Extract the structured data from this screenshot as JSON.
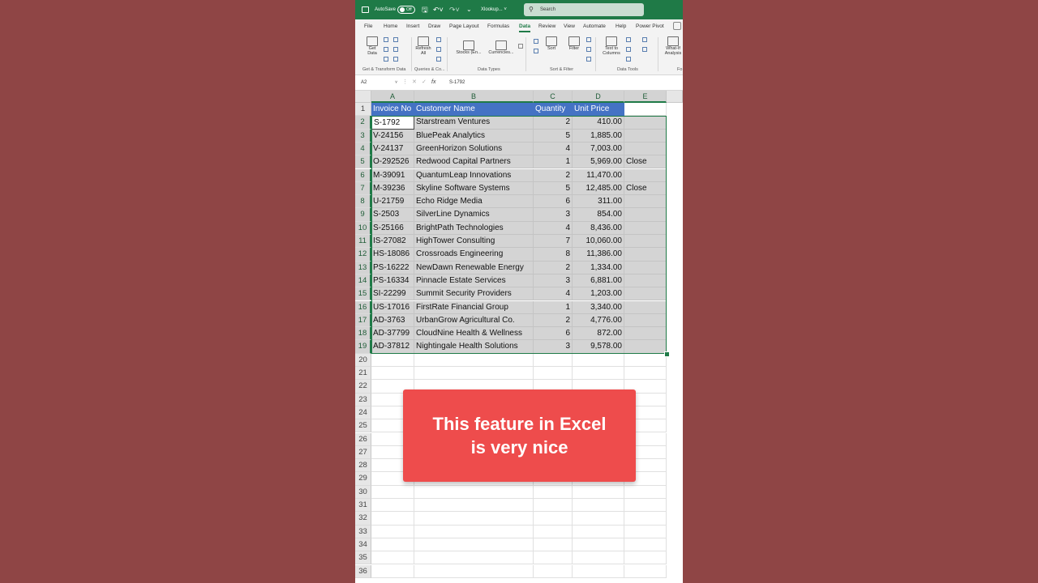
{
  "titlebar": {
    "autosave_label": "AutoSave",
    "toggle_label": "Off",
    "file_name": "Xlookup...",
    "search_placeholder": "Search"
  },
  "tabs": [
    {
      "label": "File"
    },
    {
      "label": "Home"
    },
    {
      "label": "Insert"
    },
    {
      "label": "Draw"
    },
    {
      "label": "Page Layout"
    },
    {
      "label": "Formulas"
    },
    {
      "label": "Data",
      "active": true
    },
    {
      "label": "Review"
    },
    {
      "label": "View"
    },
    {
      "label": "Automate"
    },
    {
      "label": "Help"
    },
    {
      "label": "Power Pivot"
    }
  ],
  "ribbon": {
    "get_data": "Get\nData",
    "refresh_all": "Refresh\nAll",
    "stocks": "Stocks (En...",
    "currencies": "Currencies...",
    "sort": "Sort",
    "filter": "Filter",
    "text_to_columns": "Text to\nColumns",
    "what_if": "What-If\nAnalysis",
    "groups": {
      "get_transform": "Get & Transform Data",
      "queries": "Queries & Co...",
      "data_types": "Data Types",
      "sort_filter": "Sort & Filter",
      "data_tools": "Data Tools",
      "forecast": "Fo"
    }
  },
  "formula_bar": {
    "name_box": "A2",
    "fx": "fx",
    "value": "S-1792"
  },
  "columns": [
    "A",
    "B",
    "C",
    "D",
    "E"
  ],
  "rows": [
    "1",
    "2",
    "3",
    "4",
    "5",
    "6",
    "7",
    "8",
    "9",
    "10",
    "11",
    "12",
    "13",
    "14",
    "15",
    "16",
    "17",
    "18",
    "19",
    "20",
    "21",
    "22",
    "23",
    "24",
    "25",
    "26",
    "27",
    "28",
    "29",
    "30",
    "31",
    "32",
    "33",
    "34",
    "35",
    "36"
  ],
  "table": {
    "headers": [
      "Invoice No",
      "Customer Name",
      "Quantity",
      "Unit Price"
    ],
    "data": [
      [
        "S-1792",
        "Starstream Ventures",
        "2",
        "410.00",
        ""
      ],
      [
        "V-24156",
        "BluePeak Analytics",
        "5",
        "1,885.00",
        ""
      ],
      [
        "V-24137",
        "GreenHorizon Solutions",
        "4",
        "7,003.00",
        ""
      ],
      [
        "O-292526",
        "Redwood Capital Partners",
        "1",
        "5,969.00",
        "Close"
      ],
      [
        "M-39091",
        "QuantumLeap Innovations",
        "2",
        "11,470.00",
        ""
      ],
      [
        "M-39236",
        "Skyline Software Systems",
        "5",
        "12,485.00",
        "Close"
      ],
      [
        "U-21759",
        "Echo Ridge Media",
        "6",
        "311.00",
        ""
      ],
      [
        "S-2503",
        "SilverLine Dynamics",
        "3",
        "854.00",
        ""
      ],
      [
        "S-25166",
        "BrightPath Technologies",
        "4",
        "8,436.00",
        ""
      ],
      [
        "IS-27082",
        "HighTower Consulting",
        "7",
        "10,060.00",
        ""
      ],
      [
        "HS-18086",
        "Crossroads Engineering",
        "8",
        "11,386.00",
        ""
      ],
      [
        "PS-16222",
        "NewDawn Renewable Energy",
        "2",
        "1,334.00",
        ""
      ],
      [
        "PS-16334",
        "Pinnacle Estate Services",
        "3",
        "6,881.00",
        ""
      ],
      [
        "SI-22299",
        "Summit Security Providers",
        "4",
        "1,203.00",
        ""
      ],
      [
        "US-17016",
        "FirstRate Financial Group",
        "1",
        "3,340.00",
        ""
      ],
      [
        "AD-3763",
        "UrbanGrow Agricultural Co.",
        "2",
        "4,776.00",
        ""
      ],
      [
        "AD-37799",
        "CloudNine Health & Wellness",
        "6",
        "872.00",
        ""
      ],
      [
        "AD-37812",
        "Nightingale Health Solutions",
        "3",
        "9,578.00",
        ""
      ]
    ]
  },
  "caption": {
    "line1": "This feature in Excel",
    "line2": "is very nice"
  }
}
